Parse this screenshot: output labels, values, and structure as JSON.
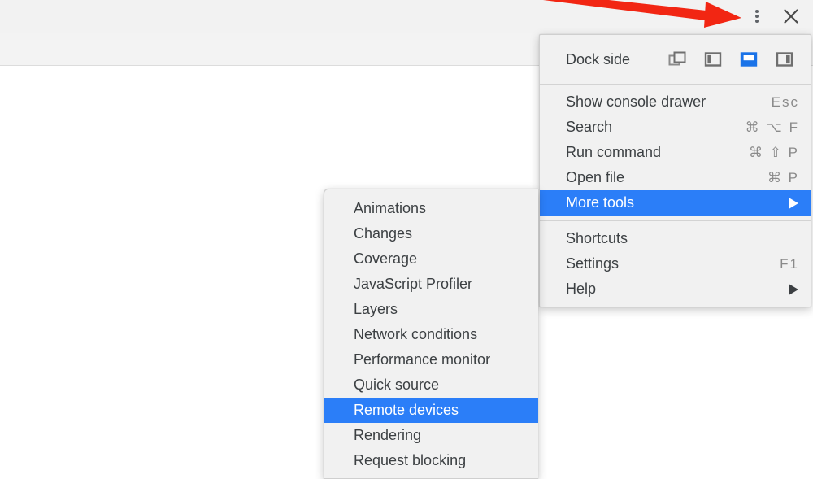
{
  "window": {
    "kebab_icon": "kebab-menu-icon",
    "close_icon": "close-icon"
  },
  "annotation": {
    "type": "red-arrow",
    "color": "#f22613",
    "points_to": "kebab-menu-icon"
  },
  "main_menu": {
    "dock_side": {
      "label": "Dock side",
      "options": [
        {
          "name": "undock-into-separate-window",
          "icon": "undock-window-icon",
          "active": false
        },
        {
          "name": "dock-to-left",
          "icon": "dock-left-icon",
          "active": false
        },
        {
          "name": "dock-to-bottom",
          "icon": "dock-bottom-icon",
          "active": true
        },
        {
          "name": "dock-to-right",
          "icon": "dock-right-icon",
          "active": false
        }
      ],
      "active_color": "#1a73e8"
    },
    "groups": [
      {
        "items": [
          {
            "label": "Show console drawer",
            "shortcut": "Esc",
            "selected": false,
            "submenu": false
          },
          {
            "label": "Search",
            "shortcut": "⌘ ⌥ F",
            "selected": false,
            "submenu": false
          },
          {
            "label": "Run command",
            "shortcut": "⌘ ⇧ P",
            "selected": false,
            "submenu": false
          },
          {
            "label": "Open file",
            "shortcut": "⌘ P",
            "selected": false,
            "submenu": false
          },
          {
            "label": "More tools",
            "shortcut": "",
            "selected": true,
            "submenu": true
          }
        ]
      },
      {
        "items": [
          {
            "label": "Shortcuts",
            "shortcut": "",
            "selected": false,
            "submenu": false
          },
          {
            "label": "Settings",
            "shortcut": "F1",
            "selected": false,
            "submenu": false
          },
          {
            "label": "Help",
            "shortcut": "",
            "selected": false,
            "submenu": true
          }
        ]
      }
    ]
  },
  "more_tools_submenu": {
    "items": [
      {
        "label": "Animations",
        "selected": false
      },
      {
        "label": "Changes",
        "selected": false
      },
      {
        "label": "Coverage",
        "selected": false
      },
      {
        "label": "JavaScript Profiler",
        "selected": false
      },
      {
        "label": "Layers",
        "selected": false
      },
      {
        "label": "Network conditions",
        "selected": false
      },
      {
        "label": "Performance monitor",
        "selected": false
      },
      {
        "label": "Quick source",
        "selected": false
      },
      {
        "label": "Remote devices",
        "selected": true
      },
      {
        "label": "Rendering",
        "selected": false
      },
      {
        "label": "Request blocking",
        "selected": false
      }
    ],
    "highlight_color": "#2b7ef8"
  }
}
